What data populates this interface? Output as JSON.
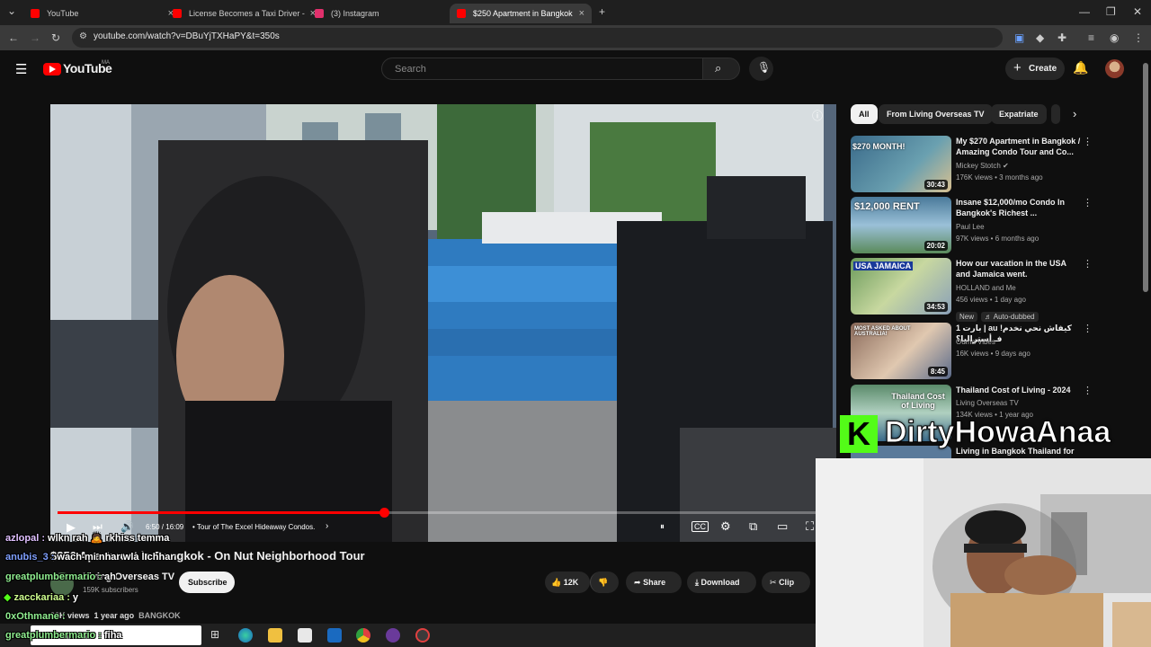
{
  "browser": {
    "tabs": [
      {
        "title": "YouTube",
        "icon": "youtube-favicon",
        "color": "#ff0000",
        "active": false
      },
      {
        "title": "License Becomes a Taxi Driver -",
        "icon": "youtube-favicon",
        "color": "#ff0000",
        "active": false
      },
      {
        "title": "(3) Instagram",
        "icon": "instagram-favicon",
        "color": "#e1306c",
        "active": false
      },
      {
        "title": "$250 Apartment in Bangkok - C",
        "icon": "youtube-favicon",
        "color": "#ff0000",
        "active": true
      }
    ],
    "url": "youtube.com/watch?v=DBuYjTXHaPY&t=350s"
  },
  "masthead": {
    "logo_text": "YouTube",
    "region": "MA",
    "search_placeholder": "Search",
    "create_label": "Create"
  },
  "player": {
    "time": "6:50 / 16:09",
    "chapter": "• Tour of The Excel Hideaway Condos.",
    "progress": 0.4236
  },
  "chips": [
    "All",
    "From Living Overseas TV",
    "Expatriate"
  ],
  "recommended": [
    {
      "title": "My $270 Apartment in Bangkok / Amazing Condo Tour and Co...",
      "channel": "Mickey Stotch",
      "verified": true,
      "meta": "176K views • 3 months ago",
      "duration": "30:43",
      "thumb_text": "$270 MONTH!",
      "thumb_color": "#3a6a8a"
    },
    {
      "title": "Insane $12,000/mo Condo In Bangkok's Richest ...",
      "channel": "Paul Lee",
      "verified": false,
      "meta": "97K views • 6 months ago",
      "duration": "20:02",
      "thumb_text": "$12,000 RENT",
      "thumb_color": "#4a7a9a"
    },
    {
      "title": "How our vacation in the USA and Jamaica went.",
      "channel": "HOLLAND and Me",
      "verified": false,
      "meta": "456 views • 1 day ago",
      "badges": [
        "New",
        "Auto-dubbed"
      ],
      "duration": "34:53",
      "thumb_text": "USA JAMAICA",
      "thumb_color": "#6a9a5a"
    },
    {
      "title": "1 بارت | au !كيفاش نحي نخدم فـ أستراليا؟",
      "channel": "Ouma Vibes",
      "verified": false,
      "meta": "16K views • 9 days ago",
      "duration": "8:45",
      "thumb_text": "MOST ASKED ABOUT AUSTRALIA!",
      "thumb_color": "#8a6a5a"
    },
    {
      "title": "Thailand Cost of Living - 2024",
      "channel": "Living Overseas TV",
      "verified": false,
      "meta": "134K views • 1 year ago",
      "duration": "",
      "thumb_text": "Thailand Cost of Living",
      "thumb_color": "#5a8a6a"
    },
    {
      "title": "Living in Bangkok Thailand for",
      "channel": "",
      "verified": false,
      "meta": "",
      "duration": "",
      "thumb_text": "",
      "thumb_color": "#5a7a9a"
    }
  ],
  "video": {
    "title": "$250 Apartment in Bangkok - On Nut Neighborhood Tour",
    "channel": "Living Overseas TV",
    "subscribers": "159K subscribers",
    "subscribe_label": "Subscribe",
    "likes": "12K",
    "share_label": "Share",
    "download_label": "Download",
    "clip_label": "Clip",
    "views": "23K views",
    "age": "1 year ago",
    "tag": "BANGKOK"
  },
  "stream": {
    "logo": "K",
    "name": "DirtyHowaAnaa",
    "brand_color": "#53fc18"
  },
  "chat": [
    {
      "user": "azlopal :",
      "msg": "wlkn rah 🙇 rkhiss temma",
      "color": "#e0c0ff"
    },
    {
      "user": "anubis_3 :",
      "msg": "wach mi nhar wla l chhar",
      "color": "#80a0ff"
    },
    {
      "user": "greatplumbermario :",
      "msg": "ah",
      "color": "#90ee90"
    },
    {
      "user": "zacckariaa :",
      "msg": "y",
      "color": "#d0ff90"
    },
    {
      "user": "0xOthmane :",
      "msg": "",
      "color": "#90ee90"
    },
    {
      "user": "greatplumbermario :",
      "msg": "fiha",
      "color": "#90ee90"
    }
  ]
}
